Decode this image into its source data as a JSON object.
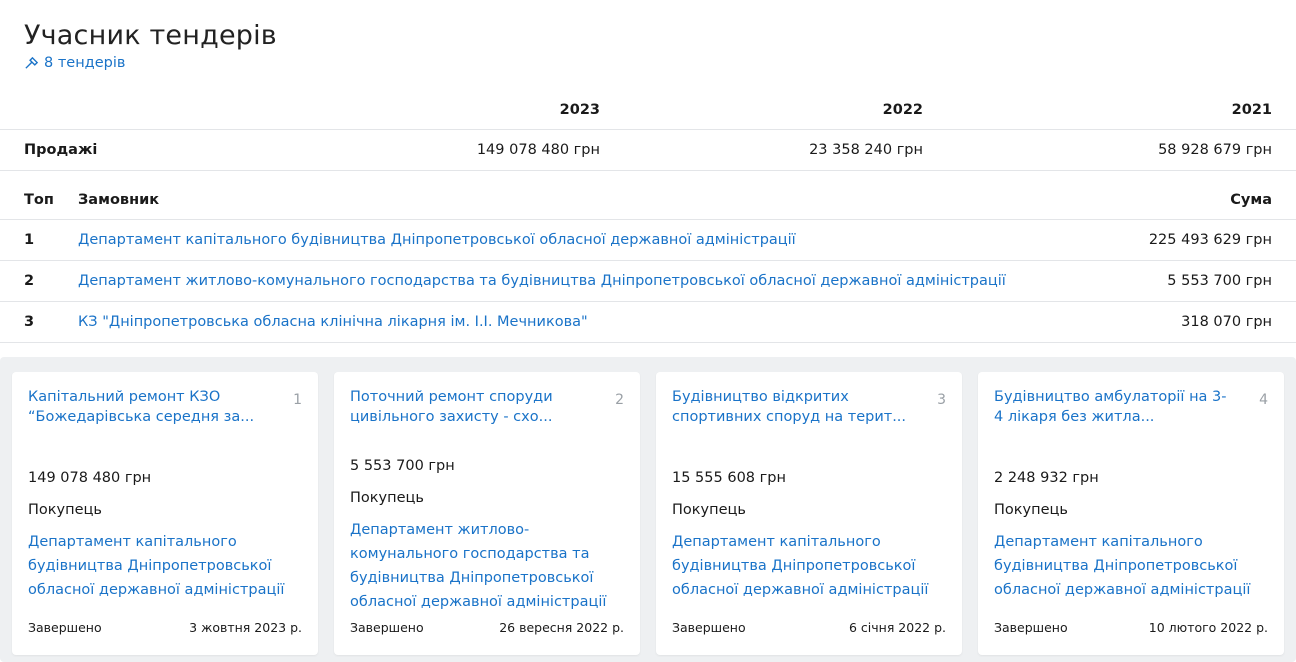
{
  "title": "Учасник тендерів",
  "tenders_link": "8 тендерів",
  "years": [
    "2023",
    "2022",
    "2021"
  ],
  "sales": {
    "label": "Продажі",
    "values": [
      "149 078 480 грн",
      "23 358 240 грн",
      "58 928 679 грн"
    ]
  },
  "top_table": {
    "headers": {
      "top": "Топ",
      "customer": "Замовник",
      "sum": "Сума"
    },
    "rows": [
      {
        "rank": "1",
        "customer": "Департамент капітального будівництва Дніпропетровської обласної державної адміністрації",
        "sum": "225 493 629 грн"
      },
      {
        "rank": "2",
        "customer": "Департамент житлово-комунального господарства та будівництва Дніпропетровської обласної державної адміністрації",
        "sum": "5 553 700 грн"
      },
      {
        "rank": "3",
        "customer": "КЗ \"Дніпропетровська обласна клінічна лікарня ім. І.І. Мечникова\"",
        "sum": "318 070 грн"
      }
    ]
  },
  "cards": [
    {
      "title": "Капітальний ремонт КЗО “Божедарівська середня за...",
      "number": "1",
      "amount": "149 078 480 грн",
      "buyer_label": "Покупець",
      "buyer": "Департамент капітального будівництва Дніпропетровської обласної державної адміністрації",
      "status": "Завершено",
      "date": "3 жовтня 2023 р."
    },
    {
      "title": "Поточний ремонт споруди цивільного захисту - схо...",
      "number": "2",
      "amount": "5 553 700 грн",
      "buyer_label": "Покупець",
      "buyer": "Департамент житлово-комунального господарства та будівництва Дніпропетровської обласної державної адміністрації",
      "status": "Завершено",
      "date": "26 вересня 2022 р."
    },
    {
      "title": "Будівництво відкритих спортивних споруд на терит...",
      "number": "3",
      "amount": "15 555 608 грн",
      "buyer_label": "Покупець",
      "buyer": "Департамент капітального будівництва Дніпропетровської обласної державної адміністрації",
      "status": "Завершено",
      "date": "6 січня 2022 р."
    },
    {
      "title": "Будівництво амбулаторії на 3-4 лікаря без житла...",
      "number": "4",
      "amount": "2 248 932 грн",
      "buyer_label": "Покупець",
      "buyer": "Департамент капітального будівництва Дніпропетровської обласної державної адміністрації",
      "status": "Завершено",
      "date": "10 лютого 2022 р."
    }
  ],
  "colors": {
    "link": "#1a73c8",
    "cards_background": "#eef0f2"
  }
}
